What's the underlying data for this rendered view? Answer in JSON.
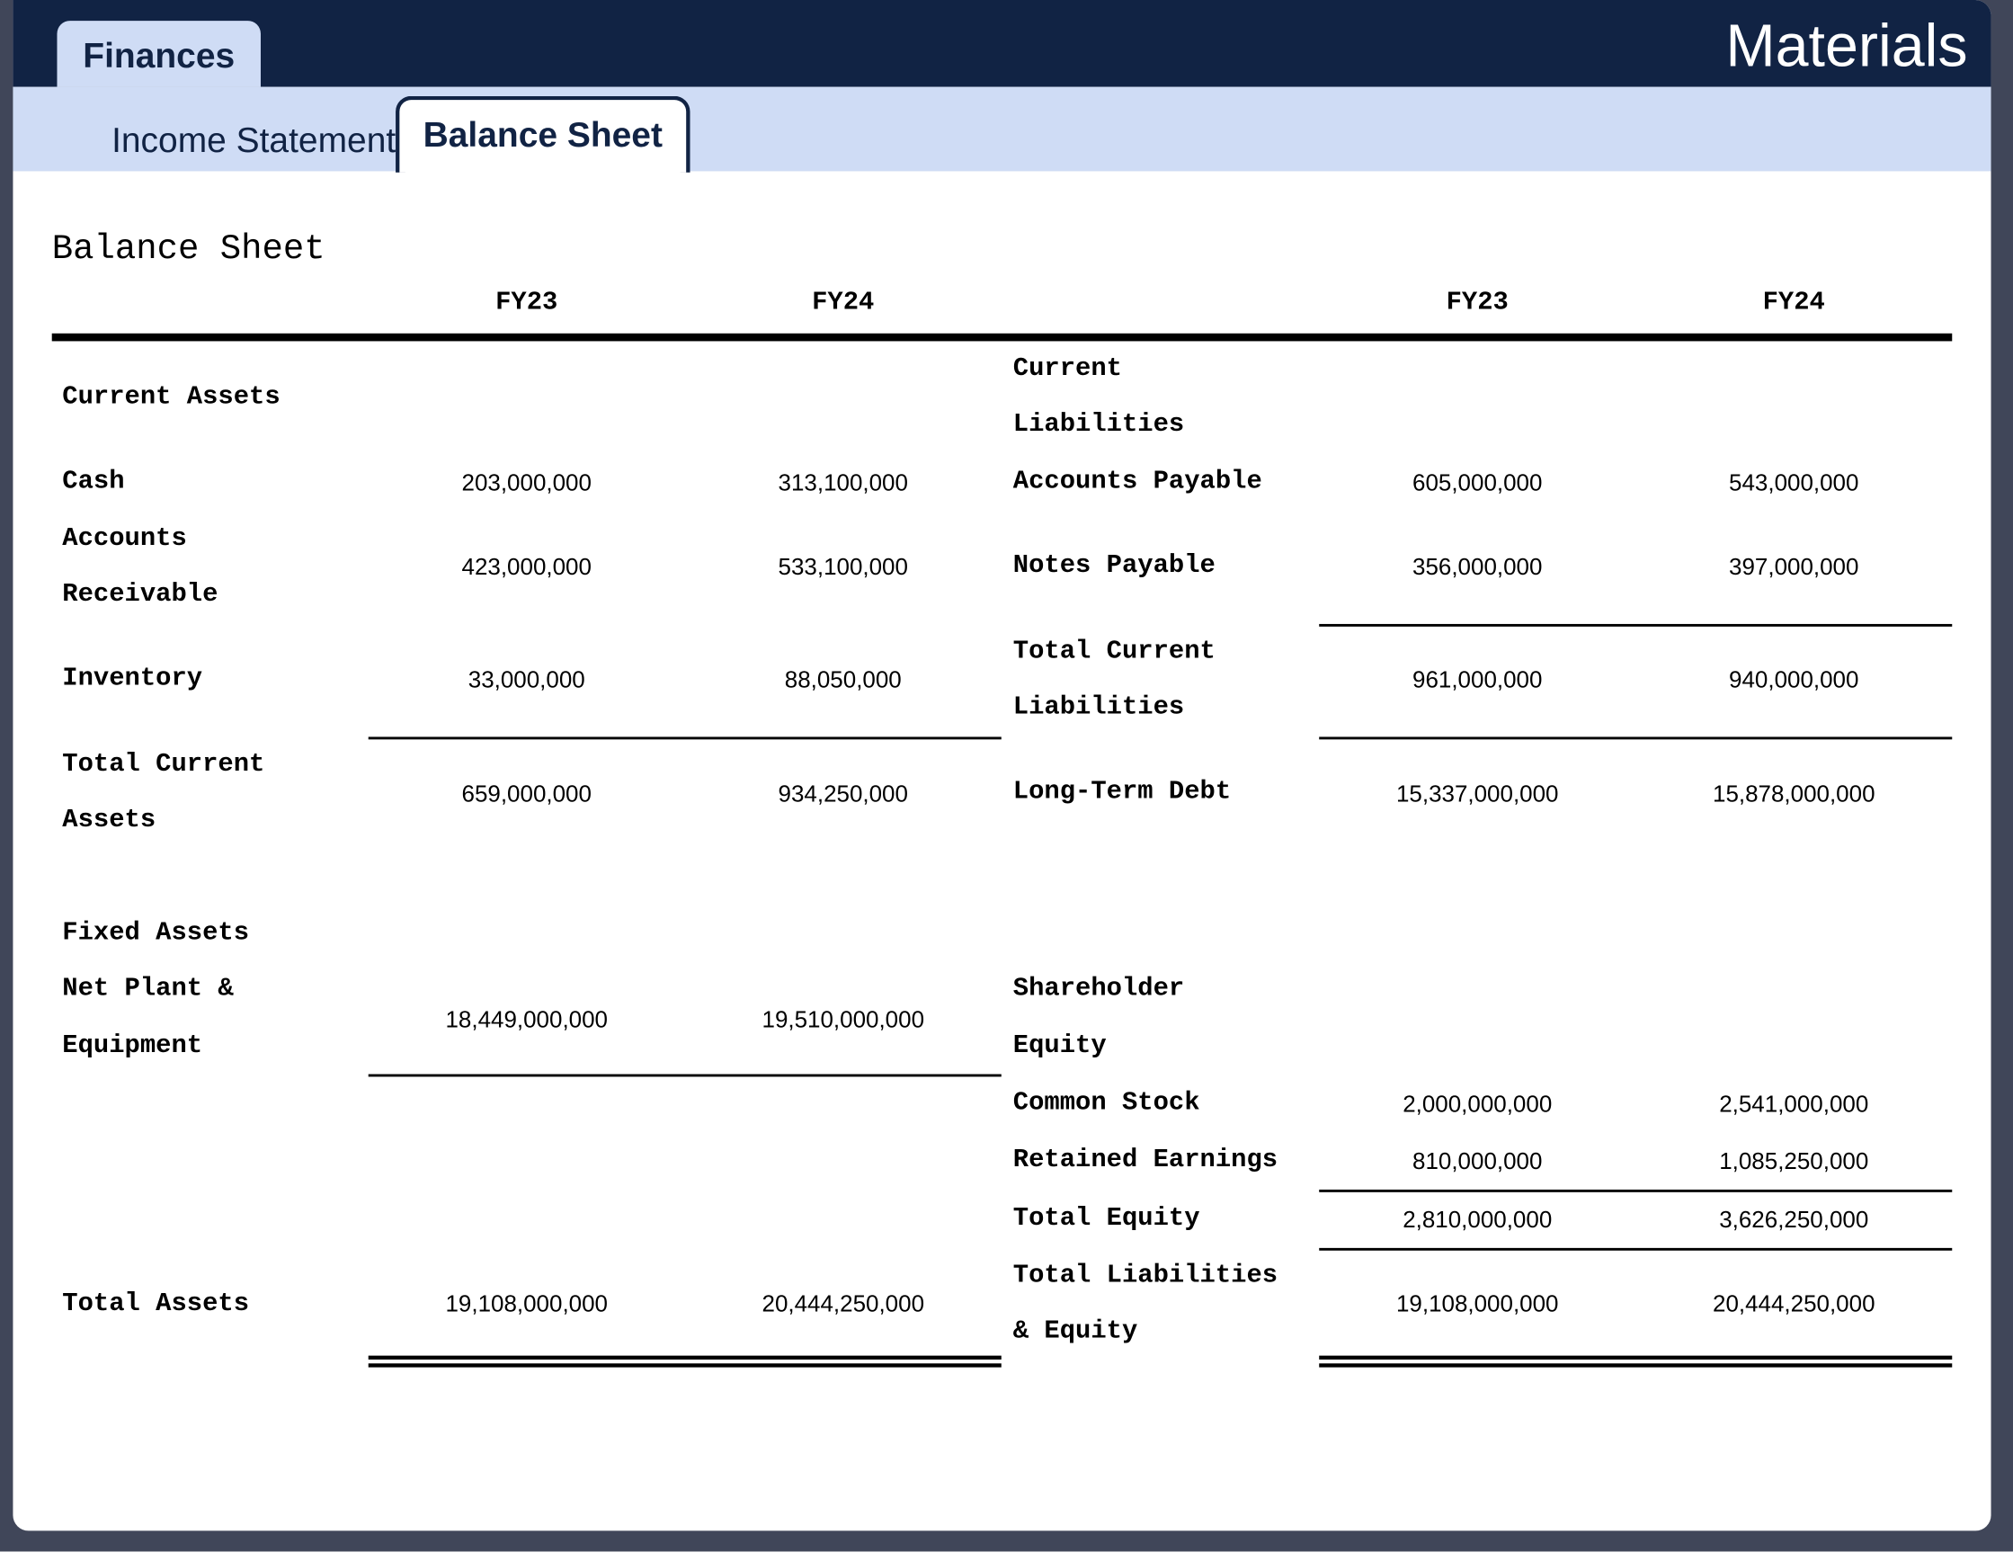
{
  "app": {
    "tab_label": "Finances",
    "title": "Materials"
  },
  "subtabs": {
    "income": "Income Statement",
    "balance": "Balance Sheet"
  },
  "sheet": {
    "title": "Balance Sheet",
    "col_fy23": "FY23",
    "col_fy24": "FY24"
  },
  "assets": {
    "current_assets_heading": "Current Assets",
    "cash": {
      "label": "Cash",
      "fy23": "203,000,000",
      "fy24": "313,100,000"
    },
    "accounts_receivable": {
      "label_line1": "Accounts",
      "label_line2": "Receivable",
      "fy23": "423,000,000",
      "fy24": "533,100,000"
    },
    "inventory": {
      "label": "Inventory",
      "fy23": "33,000,000",
      "fy24": "88,050,000"
    },
    "total_current_assets": {
      "label_line1": "Total Current",
      "label_line2": "Assets",
      "fy23": "659,000,000",
      "fy24": "934,250,000"
    },
    "fixed_assets_heading": "Fixed Assets",
    "net_ppe": {
      "label_line1": "Net Plant &",
      "label_line2": "Equipment",
      "fy23": "18,449,000,000",
      "fy24": "19,510,000,000"
    },
    "total_assets": {
      "label": "Total Assets",
      "fy23": "19,108,000,000",
      "fy24": "20,444,250,000"
    }
  },
  "liabilities": {
    "current_liabilities_heading_line1": "Current",
    "current_liabilities_heading_line2": "Liabilities",
    "accounts_payable": {
      "label": "Accounts Payable",
      "fy23": "605,000,000",
      "fy24": "543,000,000"
    },
    "notes_payable": {
      "label": "Notes Payable",
      "fy23": "356,000,000",
      "fy24": "397,000,000"
    },
    "total_current_liabilities": {
      "label_line1": "Total Current",
      "label_line2": "Liabilities",
      "fy23": "961,000,000",
      "fy24": "940,000,000"
    },
    "long_term_debt": {
      "label": "Long-Term Debt",
      "fy23": "15,337,000,000",
      "fy24": "15,878,000,000"
    },
    "shareholder_equity_heading_line1": "Shareholder",
    "shareholder_equity_heading_line2": "Equity",
    "common_stock": {
      "label": "Common Stock",
      "fy23": "2,000,000,000",
      "fy24": "2,541,000,000"
    },
    "retained_earnings": {
      "label": "Retained Earnings",
      "fy23": "810,000,000",
      "fy24": "1,085,250,000"
    },
    "total_equity": {
      "label": "Total Equity",
      "fy23": "2,810,000,000",
      "fy24": "3,626,250,000"
    },
    "total_liabilities_equity": {
      "label_line1": "Total Liabilities",
      "label_line2": "& Equity",
      "fy23": "19,108,000,000",
      "fy24": "20,444,250,000"
    }
  }
}
